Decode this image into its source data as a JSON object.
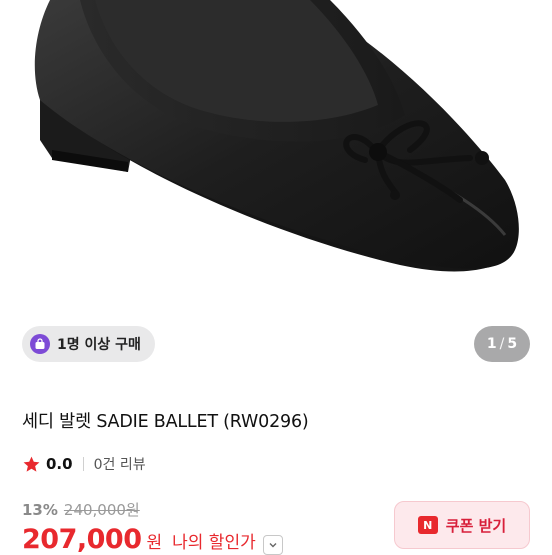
{
  "badge": {
    "label": "1명 이상 구매"
  },
  "pager": {
    "current": "1",
    "separator": "/",
    "total": "5"
  },
  "product": {
    "title": "세디 발렛 SADIE BALLET (RW0296)"
  },
  "rating": {
    "score": "0.0",
    "reviews": "0건 리뷰"
  },
  "price": {
    "discount_rate": "13%",
    "original": "240,000원",
    "sale": "207,000",
    "unit": "원",
    "my_price_label": "나의 할인가"
  },
  "coupon": {
    "label": "쿠폰 받기",
    "icon_text": "N"
  },
  "icons": {
    "badge": "shopping-bag-icon",
    "rating": "star-icon",
    "price_toggle": "chevron-down-icon",
    "coupon": "coupon-icon"
  },
  "colors": {
    "accent_red": "#e8292e",
    "badge_purple": "#7d4bd6",
    "coupon_bg": "#fde9ec"
  }
}
